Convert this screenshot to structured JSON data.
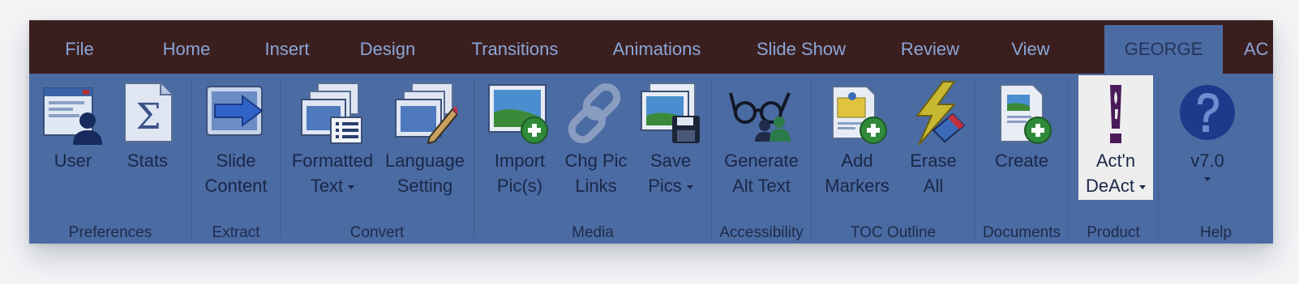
{
  "tabs": [
    {
      "label": "File"
    },
    {
      "label": "Home"
    },
    {
      "label": "Insert"
    },
    {
      "label": "Design"
    },
    {
      "label": "Transitions"
    },
    {
      "label": "Animations"
    },
    {
      "label": "Slide Show"
    },
    {
      "label": "Review"
    },
    {
      "label": "View"
    },
    {
      "label": "GEORGE"
    },
    {
      "label": "AC"
    }
  ],
  "active_tab": "GEORGE",
  "groups": {
    "preferences": {
      "label": "Preferences",
      "user": {
        "l1": "User"
      },
      "stats": {
        "l1": "Stats"
      }
    },
    "extract": {
      "label": "Extract",
      "slide_content": {
        "l1": "Slide",
        "l2": "Content"
      }
    },
    "convert": {
      "label": "Convert",
      "formatted_text": {
        "l1": "Formatted",
        "l2": "Text"
      },
      "language_setting": {
        "l1": "Language",
        "l2": "Setting"
      }
    },
    "media": {
      "label": "Media",
      "import_pics": {
        "l1": "Import",
        "l2": "Pic(s)"
      },
      "chg_pic_links": {
        "l1": "Chg Pic",
        "l2": "Links"
      },
      "save_pics": {
        "l1": "Save",
        "l2": "Pics"
      }
    },
    "accessibility": {
      "label": "Accessibility",
      "generate_alt_text": {
        "l1": "Generate",
        "l2": "Alt Text"
      }
    },
    "toc_outline": {
      "label": "TOC Outline",
      "add_markers": {
        "l1": "Add",
        "l2": "Markers"
      },
      "erase_all": {
        "l1": "Erase",
        "l2": "All"
      }
    },
    "documents": {
      "label": "Documents",
      "create": {
        "l1": "Create"
      }
    },
    "product": {
      "label": "Product",
      "actn_deact": {
        "l1": "Act'n",
        "l2": "DeAct"
      }
    },
    "help": {
      "label": "Help",
      "version": {
        "l1": "v7.0"
      }
    }
  },
  "colors": {
    "tab_bar": "#3b1f1f",
    "ribbon": "#4b6ba3",
    "tab_text": "#8aa6d8",
    "label_text": "#1a2747"
  }
}
